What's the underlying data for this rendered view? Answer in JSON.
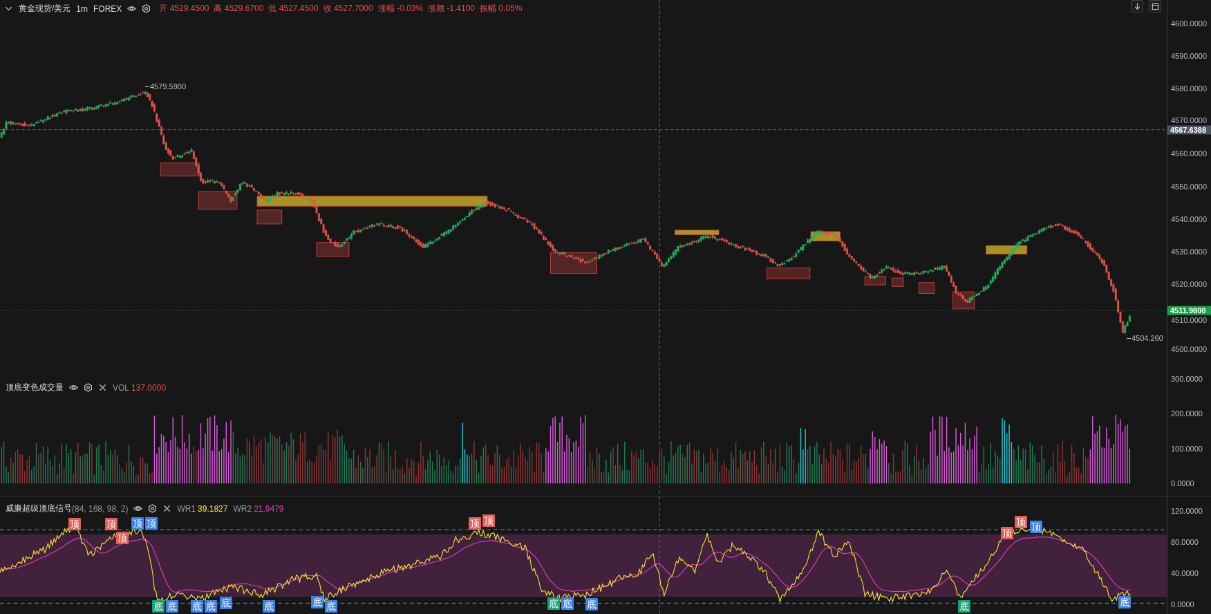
{
  "main_pane": {
    "symbol": "黄金现货/美元",
    "interval": "1m",
    "exchange": "FOREX",
    "stats": [
      {
        "label": "开",
        "value": "4529.4500"
      },
      {
        "label": "高",
        "value": "4529.6700"
      },
      {
        "label": "低",
        "value": "4527.4500"
      },
      {
        "label": "收",
        "value": "4527.7000"
      },
      {
        "label": "涨幅",
        "value": "-0.03%"
      },
      {
        "label": "涨额",
        "value": "-1.4100"
      },
      {
        "label": "振幅",
        "value": "0.05%"
      }
    ],
    "high_marker": "4579.5900",
    "low_marker": "4504.260",
    "crosshair_price": "4567.6388",
    "last_price": "4511.9800",
    "axis_labels": [
      "4600.0000",
      "4590.0000",
      "4580.0000",
      "4570.0000",
      "4560.0000",
      "4550.0000",
      "4540.0000",
      "4530.0000",
      "4520.0000",
      "4510.0000",
      "4500.0000"
    ]
  },
  "volume_pane": {
    "title": "顶底变色成交量",
    "reading_label": "VOL",
    "reading_value": "137.0000",
    "axis_labels": [
      "300.0000",
      "200.0000",
      "100.0000",
      "0.0000"
    ]
  },
  "wr_pane": {
    "title": "威廉超级顶底信号",
    "params": "(84, 168, 98, 2)",
    "readings": [
      {
        "label": "WR1",
        "value": "39.1827",
        "color": "#f2e62e"
      },
      {
        "label": "WR2",
        "value": "21.9479",
        "color": "#e040c0"
      }
    ],
    "axis_labels": [
      "120.0000",
      "80.0000",
      "40.0000",
      "0.0000"
    ],
    "markers": [
      {
        "label": "顶",
        "color": "#e45d58"
      },
      {
        "label": "顶",
        "color": "#e45d58"
      },
      {
        "label": "顶",
        "color": "#e45d58"
      },
      {
        "label": "顶",
        "color": "#3b82e6"
      },
      {
        "label": "顶",
        "color": "#3b82e6"
      },
      {
        "label": "顶",
        "color": "#e45d58"
      },
      {
        "label": "顶",
        "color": "#e45d58"
      },
      {
        "label": "顶",
        "color": "#e45d58"
      },
      {
        "label": "顶",
        "color": "#e45d58"
      },
      {
        "label": "顶",
        "color": "#3b82e6"
      },
      {
        "label": "底",
        "color": "#12a37a"
      },
      {
        "label": "底",
        "color": "#3b82e6"
      },
      {
        "label": "底",
        "color": "#3b82e6"
      },
      {
        "label": "底",
        "color": "#3b82e6"
      },
      {
        "label": "底",
        "color": "#3b82e6"
      },
      {
        "label": "底",
        "color": "#3b82e6"
      },
      {
        "label": "底",
        "color": "#3b82e6"
      },
      {
        "label": "底",
        "color": "#3b82e6"
      },
      {
        "label": "底",
        "color": "#12a37a"
      },
      {
        "label": "底",
        "color": "#3b82e6"
      },
      {
        "label": "底",
        "color": "#3b82e6"
      },
      {
        "label": "底",
        "color": "#12a37a"
      },
      {
        "label": "底",
        "color": "#3b82e6"
      }
    ]
  }
}
